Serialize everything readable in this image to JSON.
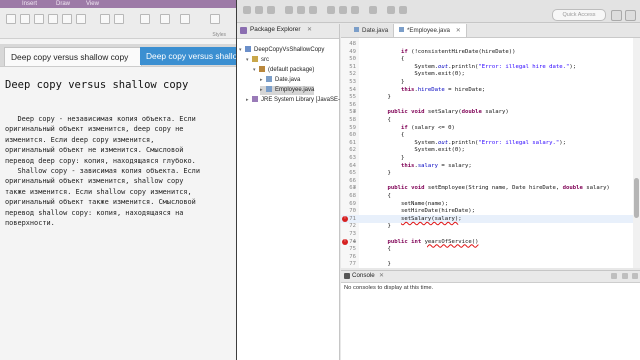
{
  "notes": {
    "ribbon_tabs": [
      "Insert",
      "Draw",
      "View"
    ],
    "styles_label": "Styles",
    "page_tabs": [
      "Deep copy versus shallow copy",
      "Deep copy versus shallow co"
    ],
    "title": "Deep copy versus shallow copy",
    "body": "   Deep copy - независимая копия объекта. Если\nоригинальный объект изменится, deep copy не\nизменится. Если deep copy изменится,\nоригинальный объект не изменится. Смысловой\nперевод deep copy: копия, находящаяся глубоко.\n   Shallow copy - зависимая копия объекта. Если\nоригинальный объект изменится, shallow copy\nтакже изменится. Если shallow copy изменится,\nоригинальный объект также изменится. Смысловой\nперевод shallow copy: копия, находящаяся на\nповерхности."
  },
  "eclipse": {
    "quick_access": "Quick Access",
    "package_explorer": {
      "title": "Package Explorer",
      "close": "✕",
      "tree": [
        {
          "label": "DeepCopyVsShallowCopy",
          "icon": "project-icon",
          "depth": 0,
          "arrow": "▾"
        },
        {
          "label": "src",
          "icon": "source-folder-icon",
          "depth": 1,
          "arrow": "▾"
        },
        {
          "label": "(default package)",
          "icon": "package-icon",
          "depth": 2,
          "arrow": "▾"
        },
        {
          "label": "Date.java",
          "icon": "java-file-icon",
          "depth": 3,
          "arrow": "▸"
        },
        {
          "label": "Employee.java",
          "icon": "java-file-icon",
          "depth": 3,
          "arrow": "▸",
          "selected": true
        },
        {
          "label": "JRE System Library [JavaSE-",
          "icon": "library-icon",
          "depth": 1,
          "arrow": "▸"
        }
      ]
    },
    "editor": {
      "tabs": [
        "Date.java",
        "*Employee.java"
      ],
      "lines": [
        {
          "n": "48",
          "code": ""
        },
        {
          "n": "49",
          "code": "        if (!consistentHireDate(hireDate))"
        },
        {
          "n": "50",
          "code": "        {"
        },
        {
          "n": "51",
          "code": "            System.out.println(\"Error: illegal hire date.\");"
        },
        {
          "n": "52",
          "code": "            System.exit(0);"
        },
        {
          "n": "53",
          "code": "        }"
        },
        {
          "n": "54",
          "code": "        this.hireDate = hireDate;"
        },
        {
          "n": "55",
          "code": "    }"
        },
        {
          "n": "56",
          "code": ""
        },
        {
          "n": "57",
          "code": "    public void setSalary(double salary)"
        },
        {
          "n": "58",
          "code": "    {"
        },
        {
          "n": "59",
          "code": "        if (salary <= 0)"
        },
        {
          "n": "60",
          "code": "        {"
        },
        {
          "n": "61",
          "code": "            System.out.println(\"Error: illegal salary.\");"
        },
        {
          "n": "62",
          "code": "            System.exit(0);"
        },
        {
          "n": "63",
          "code": "        }"
        },
        {
          "n": "64",
          "code": "        this.salary = salary;"
        },
        {
          "n": "65",
          "code": "    }"
        },
        {
          "n": "66",
          "code": ""
        },
        {
          "n": "67",
          "code": "    public void setEmployee(String name, Date hireDate, double salary)"
        },
        {
          "n": "68",
          "code": "    {"
        },
        {
          "n": "69",
          "code": "        setName(name);"
        },
        {
          "n": "70",
          "code": "        setHireDate(hireDate);"
        },
        {
          "n": "71",
          "code": "        setSalary(salary);"
        },
        {
          "n": "72",
          "code": "    }"
        },
        {
          "n": "73",
          "code": ""
        },
        {
          "n": "74",
          "code": "    public int yearsOfService()"
        },
        {
          "n": "75",
          "code": "    {"
        },
        {
          "n": "76",
          "code": ""
        },
        {
          "n": "77",
          "code": "    }"
        }
      ]
    },
    "console": {
      "title": "Console",
      "message": "No consoles to display at this time."
    }
  }
}
